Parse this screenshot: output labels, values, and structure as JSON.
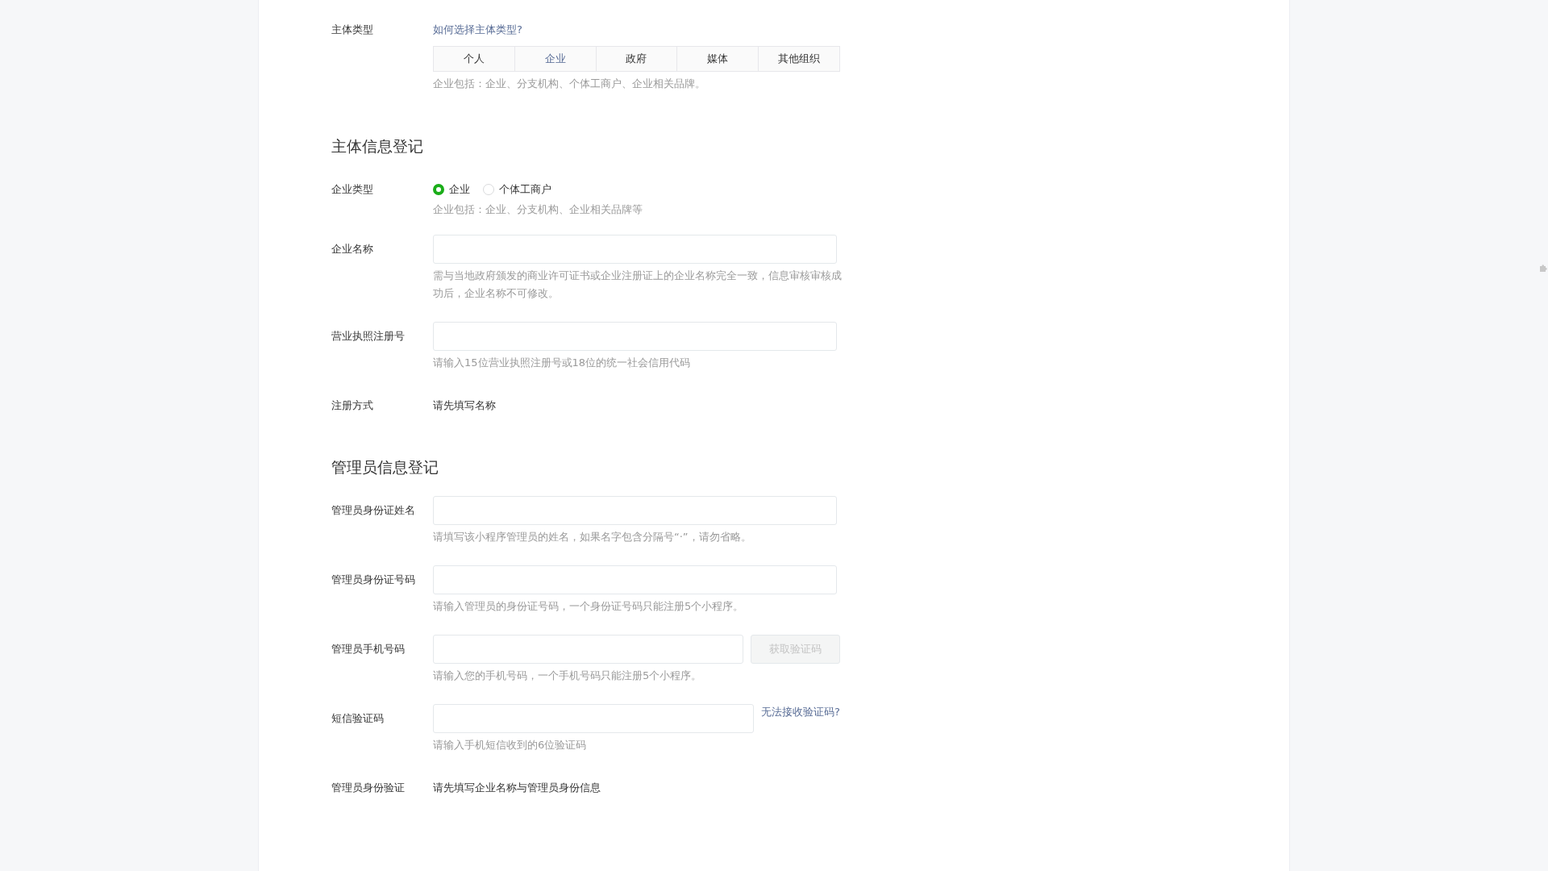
{
  "subject_type": {
    "label": "主体类型",
    "help_link": "如何选择主体类型?",
    "options": [
      {
        "label": "个人",
        "selected": false
      },
      {
        "label": "企业",
        "selected": true
      },
      {
        "label": "政府",
        "selected": false
      },
      {
        "label": "媒体",
        "selected": false
      },
      {
        "label": "其他组织",
        "selected": false
      }
    ],
    "hint": "企业包括：企业、分支机构、个体工商户、企业相关品牌。"
  },
  "sections": [
    {
      "title": "主体信息登记",
      "fields": [
        {
          "kind": "radio",
          "label": "企业类型",
          "options": [
            {
              "label": "企业",
              "selected": true
            },
            {
              "label": "个体工商户",
              "selected": false
            }
          ],
          "hint": "企业包括：企业、分支机构、企业相关品牌等"
        },
        {
          "kind": "input",
          "label": "企业名称",
          "hint": "需与当地政府颁发的商业许可证书或企业注册证上的企业名称完全一致，信息审核审核成功后，企业名称不可修改。"
        },
        {
          "kind": "input",
          "label": "营业执照注册号",
          "hint": "请输入15位营业执照注册号或18位的统一社会信用代码"
        },
        {
          "kind": "text",
          "label": "注册方式",
          "value": "请先填写名称"
        }
      ]
    },
    {
      "title": "管理员信息登记",
      "fields": [
        {
          "kind": "input",
          "label": "管理员身份证姓名",
          "hint": "请填写该小程序管理员的姓名，如果名字包含分隔号“·”，请勿省略。"
        },
        {
          "kind": "input",
          "label": "管理员身份证号码",
          "hint": "请输入管理员的身份证号码，一个身份证号码只能注册5个小程序。"
        },
        {
          "kind": "input_button",
          "label": "管理员手机号码",
          "button": {
            "label": "获取验证码",
            "disabled": true
          },
          "hint": "请输入您的手机号码，一个手机号码只能注册5个小程序。"
        },
        {
          "kind": "input_link",
          "label": "短信验证码",
          "link": "无法接收验证码?",
          "hint": "请输入手机短信收到的6位验证码"
        },
        {
          "kind": "text",
          "label": "管理员身份验证",
          "value": "请先填写企业名称与管理员身份信息"
        }
      ]
    }
  ]
}
